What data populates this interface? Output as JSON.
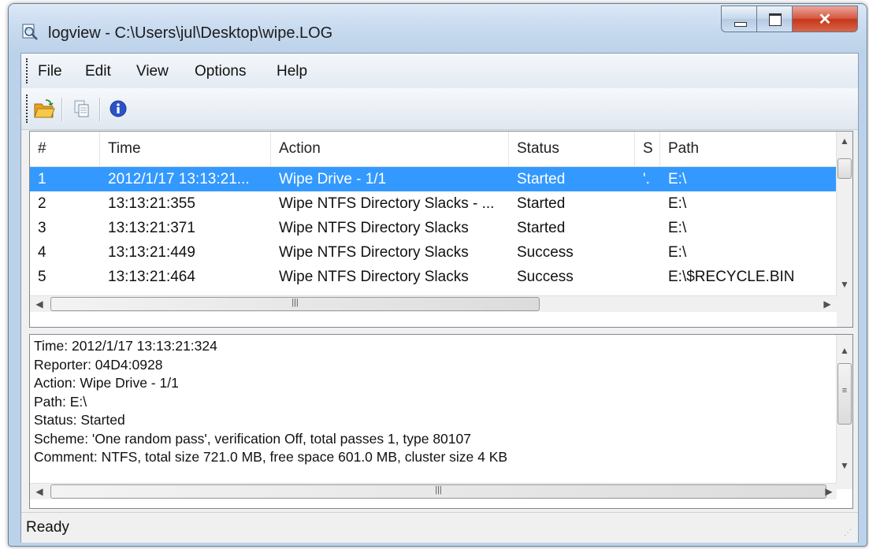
{
  "window": {
    "title": "logview - C:\\Users\\jul\\Desktop\\wipe.LOG",
    "icon": "magnifier-log-icon"
  },
  "menu": [
    "File",
    "Edit",
    "View",
    "Options",
    "Help"
  ],
  "toolbar": {
    "buttons": [
      "open-folder-icon",
      "copy-icon",
      "info-icon"
    ]
  },
  "list": {
    "columns": [
      "#",
      "Time",
      "Action",
      "Status",
      "S",
      "Path"
    ],
    "rows": [
      {
        "num": "1",
        "time": "2012/1/17 13:13:21...",
        "action": "Wipe Drive - 1/1",
        "status": "Started",
        "s": "'.",
        "path": "E:\\",
        "selected": true
      },
      {
        "num": "2",
        "time": "13:13:21:355",
        "action": "Wipe NTFS Directory Slacks - ...",
        "status": "Started",
        "s": "",
        "path": "E:\\"
      },
      {
        "num": "3",
        "time": "13:13:21:371",
        "action": "Wipe NTFS Directory Slacks",
        "status": "Started",
        "s": "",
        "path": "E:\\"
      },
      {
        "num": "4",
        "time": "13:13:21:449",
        "action": "Wipe NTFS Directory Slacks",
        "status": "Success",
        "s": "",
        "path": "E:\\"
      },
      {
        "num": "5",
        "time": "13:13:21:464",
        "action": "Wipe NTFS Directory Slacks",
        "status": "Success",
        "s": "",
        "path": "E:\\$RECYCLE.BIN"
      }
    ]
  },
  "details": [
    "Time: 2012/1/17 13:13:21:324",
    "Reporter: 04D4:0928",
    "Action: Wipe Drive - 1/1",
    "Path: E:\\",
    "Status: Started",
    "Scheme: 'One random pass', verification Off, total passes 1, type 80107",
    "Comment: NTFS, total size 721.0 MB, free space 601.0 MB, cluster size 4 KB"
  ],
  "status": "Ready",
  "colors": {
    "selection": "#3399ff",
    "close_button": "#c43618"
  }
}
